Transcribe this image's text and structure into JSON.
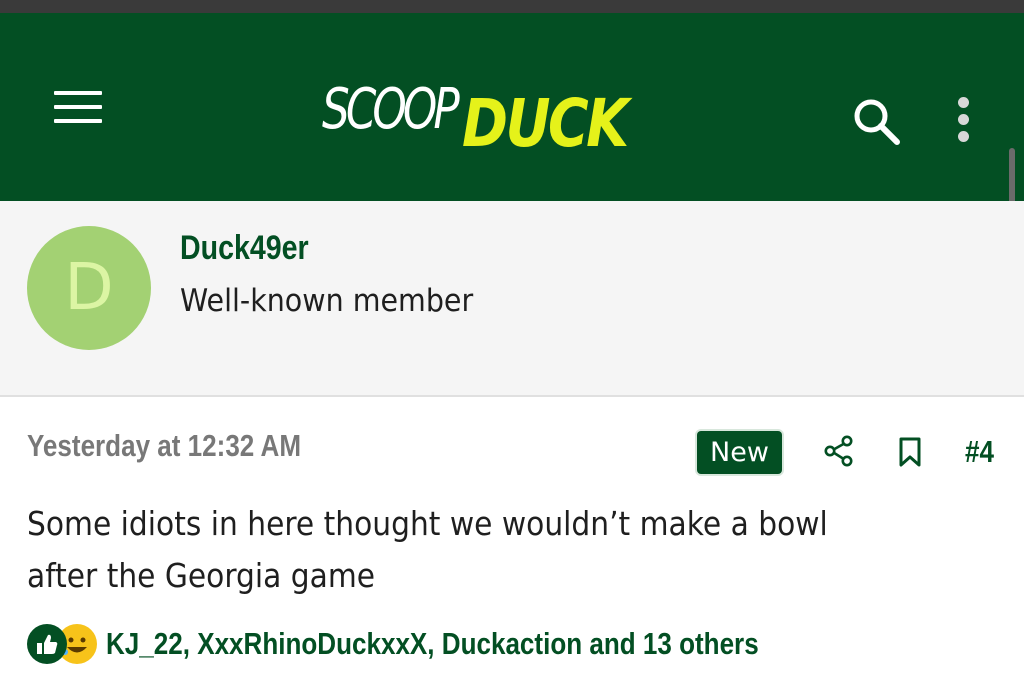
{
  "header": {
    "logo_part1": "SCOOP",
    "logo_part2": "DUCK",
    "menu_icon": "hamburger-menu-icon",
    "search_icon": "search-icon",
    "more_icon": "vertical-ellipsis-icon"
  },
  "user": {
    "avatar_letter": "D",
    "username": "Duck49er",
    "title": "Well-known member"
  },
  "post": {
    "timestamp": "Yesterday at 12:32 AM",
    "badge": "New",
    "share_icon": "share-icon",
    "bookmark_icon": "bookmark-icon",
    "number": "#4",
    "body": "Some idiots in here thought we wouldn’t make a bowl after the Georgia game"
  },
  "reactions": {
    "icons": [
      "like-icon",
      "laugh-icon"
    ],
    "summary": "KJ_22, XxxRhinoDuckxxX, Duckaction and 13 others"
  },
  "colors": {
    "brand_green": "#034f23",
    "brand_yellow": "#e5f21a",
    "avatar_bg": "#a3d173",
    "muted_text": "#787878"
  }
}
